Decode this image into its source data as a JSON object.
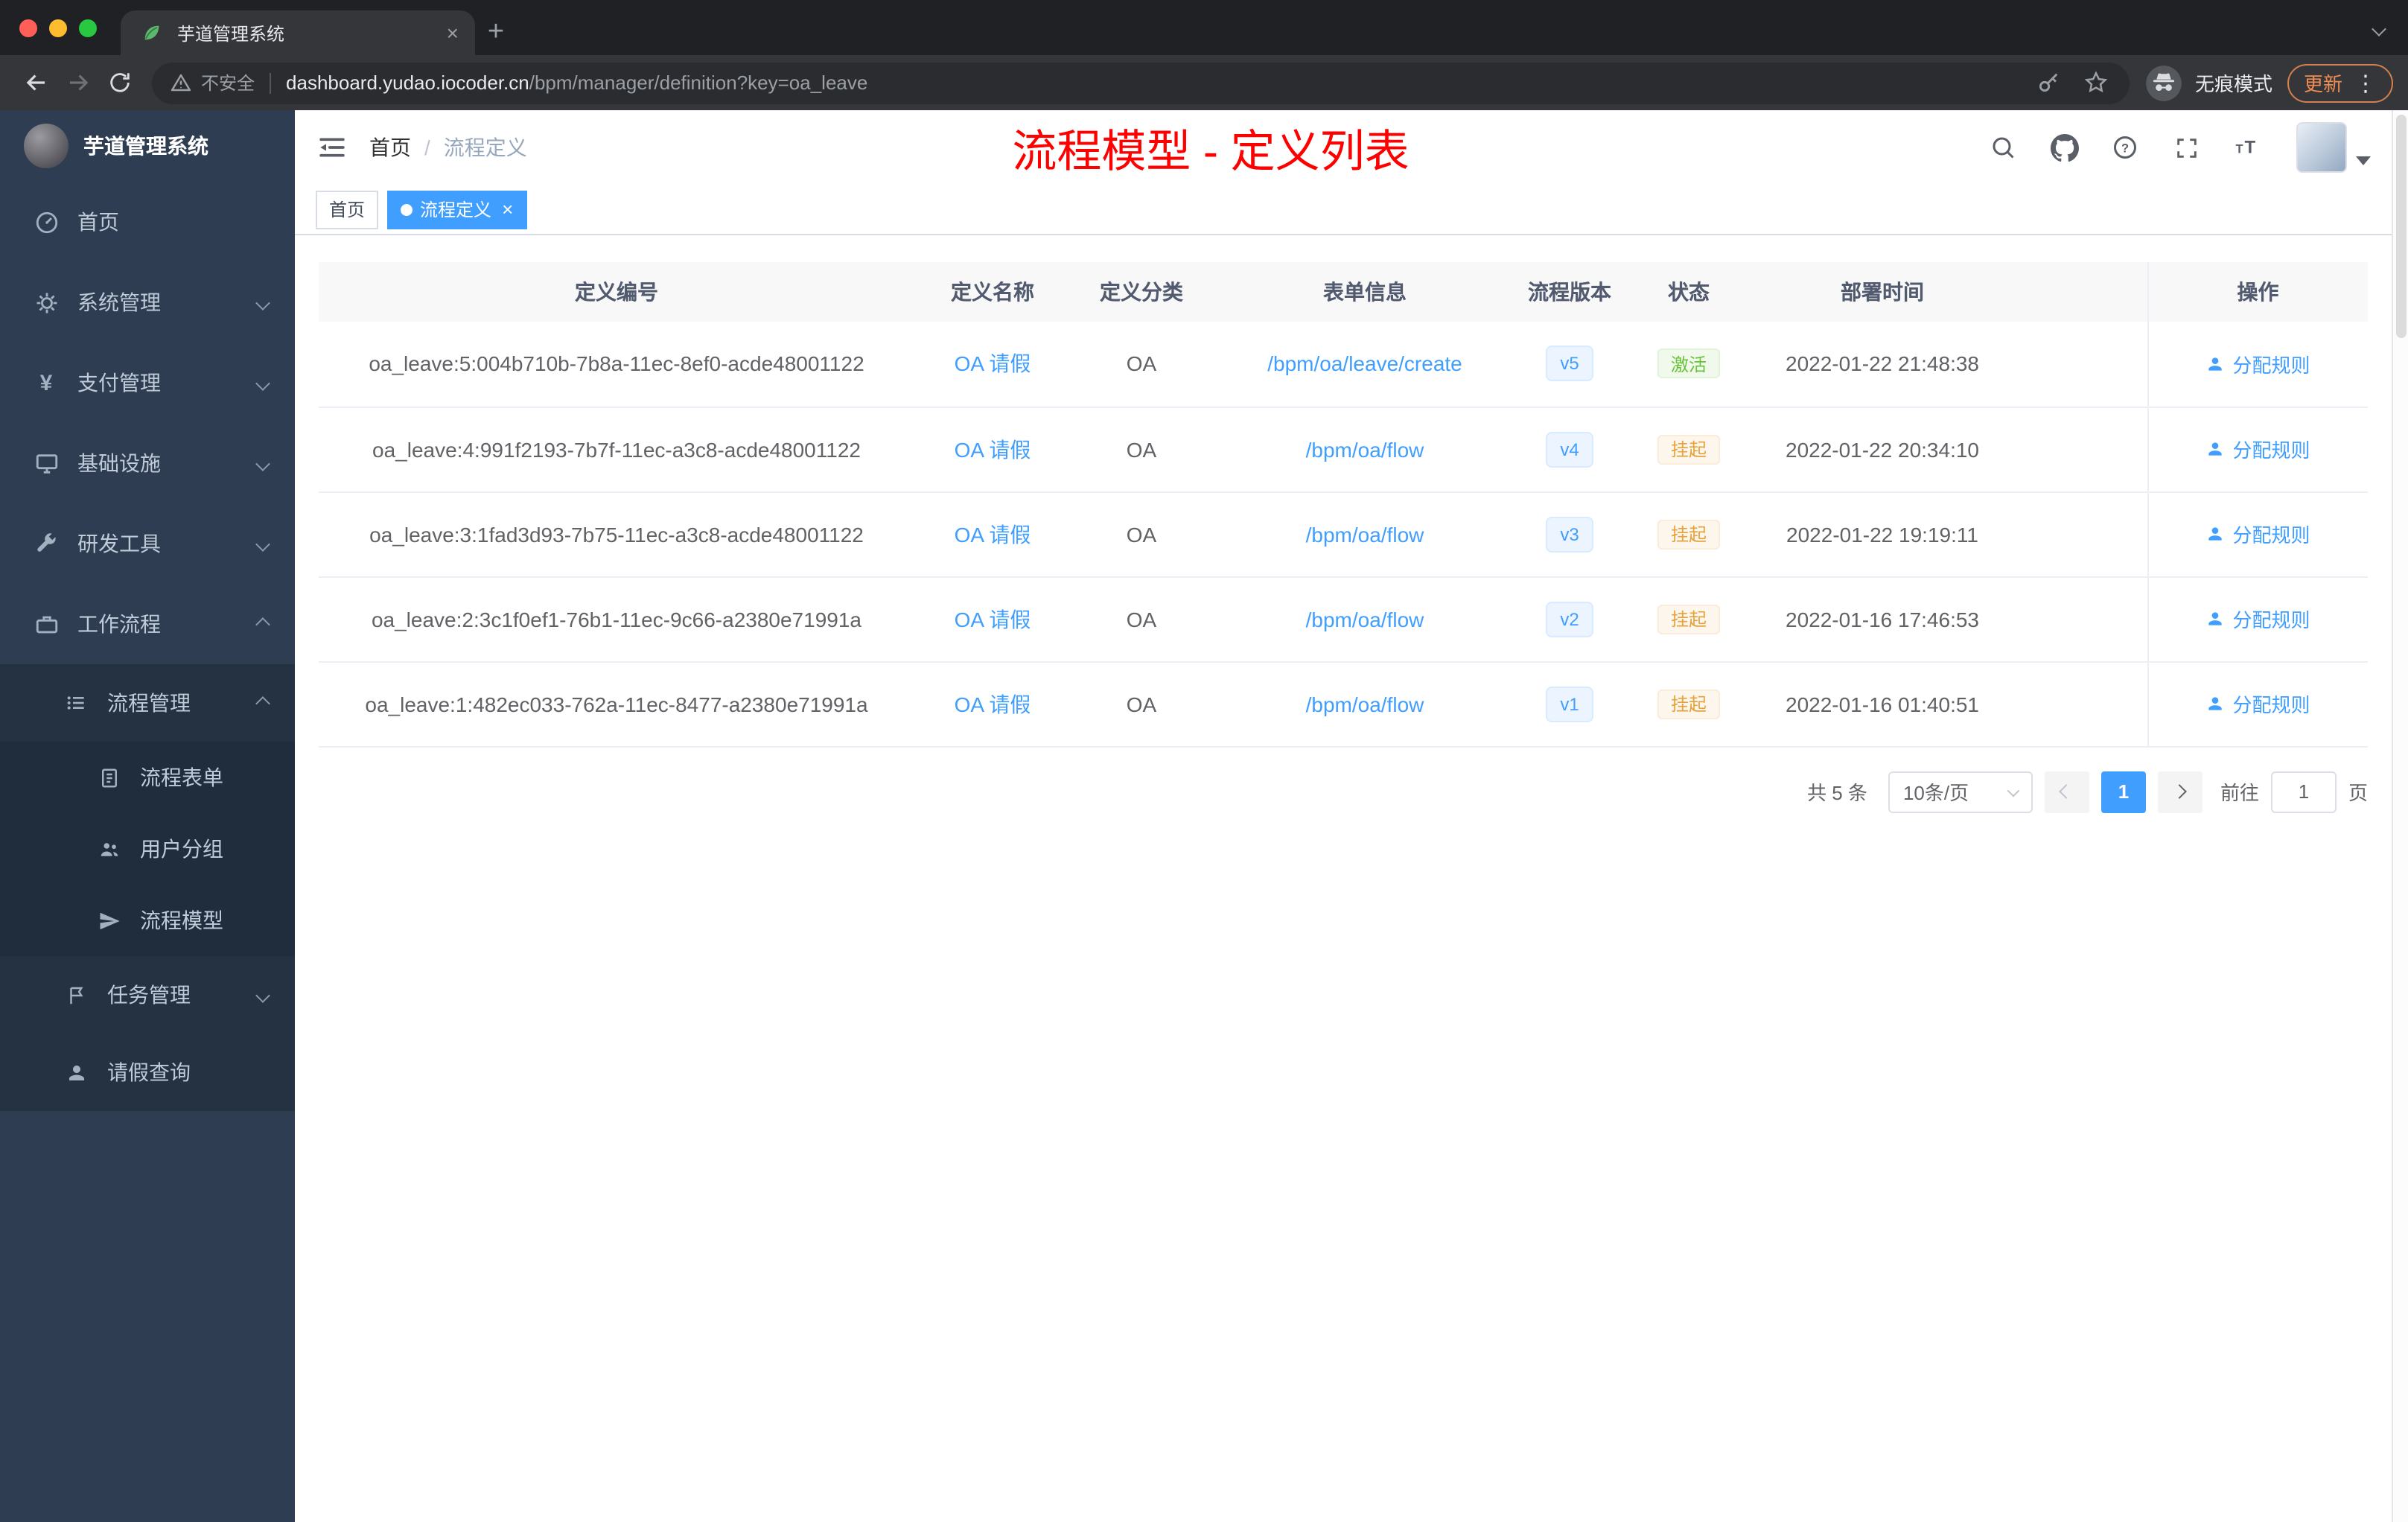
{
  "browser": {
    "tab_title": "芋道管理系统",
    "security_label": "不安全",
    "url_host": "dashboard.yudao.iocoder.cn",
    "url_path": "/bpm/manager/definition?key=oa_leave",
    "incognito_label": "无痕模式",
    "update_label": "更新"
  },
  "icons": {
    "close": "×",
    "new_tab": "+",
    "more": "⋮"
  },
  "sidebar": {
    "logo_title": "芋道管理系统",
    "items": [
      {
        "label": "首页"
      },
      {
        "label": "系统管理"
      },
      {
        "label": "支付管理"
      },
      {
        "label": "基础设施"
      },
      {
        "label": "研发工具"
      },
      {
        "label": "工作流程"
      }
    ],
    "sub_items": [
      {
        "label": "流程管理"
      },
      {
        "label": "流程表单"
      },
      {
        "label": "用户分组"
      },
      {
        "label": "流程模型"
      },
      {
        "label": "任务管理"
      },
      {
        "label": "请假查询"
      }
    ],
    "yen_glyph": "¥"
  },
  "header": {
    "breadcrumb": {
      "home": "首页",
      "separator": "/",
      "current": "流程定义"
    },
    "annotation": "流程模型 - 定义列表"
  },
  "tags": {
    "home": "首页",
    "active": "流程定义"
  },
  "table": {
    "columns": [
      "定义编号",
      "定义名称",
      "定义分类",
      "表单信息",
      "流程版本",
      "状态",
      "部署时间",
      "操作"
    ],
    "rows": [
      {
        "id": "oa_leave:5:004b710b-7b8a-11ec-8ef0-acde48001122",
        "name": "OA 请假",
        "category": "OA",
        "form": "/bpm/oa/leave/create",
        "version": "v5",
        "status": "激活",
        "time": "2022-01-22 21:48:38",
        "action": "分配规则"
      },
      {
        "id": "oa_leave:4:991f2193-7b7f-11ec-a3c8-acde48001122",
        "name": "OA 请假",
        "category": "OA",
        "form": "/bpm/oa/flow",
        "version": "v4",
        "status": "挂起",
        "time": "2022-01-22 20:34:10",
        "action": "分配规则"
      },
      {
        "id": "oa_leave:3:1fad3d93-7b75-11ec-a3c8-acde48001122",
        "name": "OA 请假",
        "category": "OA",
        "form": "/bpm/oa/flow",
        "version": "v3",
        "status": "挂起",
        "time": "2022-01-22 19:19:11",
        "action": "分配规则"
      },
      {
        "id": "oa_leave:2:3c1f0ef1-76b1-11ec-9c66-a2380e71991a",
        "name": "OA 请假",
        "category": "OA",
        "form": "/bpm/oa/flow",
        "version": "v2",
        "status": "挂起",
        "time": "2022-01-16 17:46:53",
        "action": "分配规则"
      },
      {
        "id": "oa_leave:1:482ec033-762a-11ec-8477-a2380e71991a",
        "name": "OA 请假",
        "category": "OA",
        "form": "/bpm/oa/flow",
        "version": "v1",
        "status": "挂起",
        "time": "2022-01-16 01:40:51",
        "action": "分配规则"
      }
    ]
  },
  "pagination": {
    "total": "共 5 条",
    "page_size": "10条/页",
    "current_page": "1",
    "goto_label": "前往",
    "goto_value": "1",
    "page_unit": "页"
  },
  "colors": {
    "accent": "#409eff",
    "annotation_red": "#ff0000",
    "status_active_green": "#67c23a",
    "status_suspend_orange": "#e6a23c",
    "sidebar_bg": "#2f3d52",
    "update_orange": "#f08c51"
  }
}
